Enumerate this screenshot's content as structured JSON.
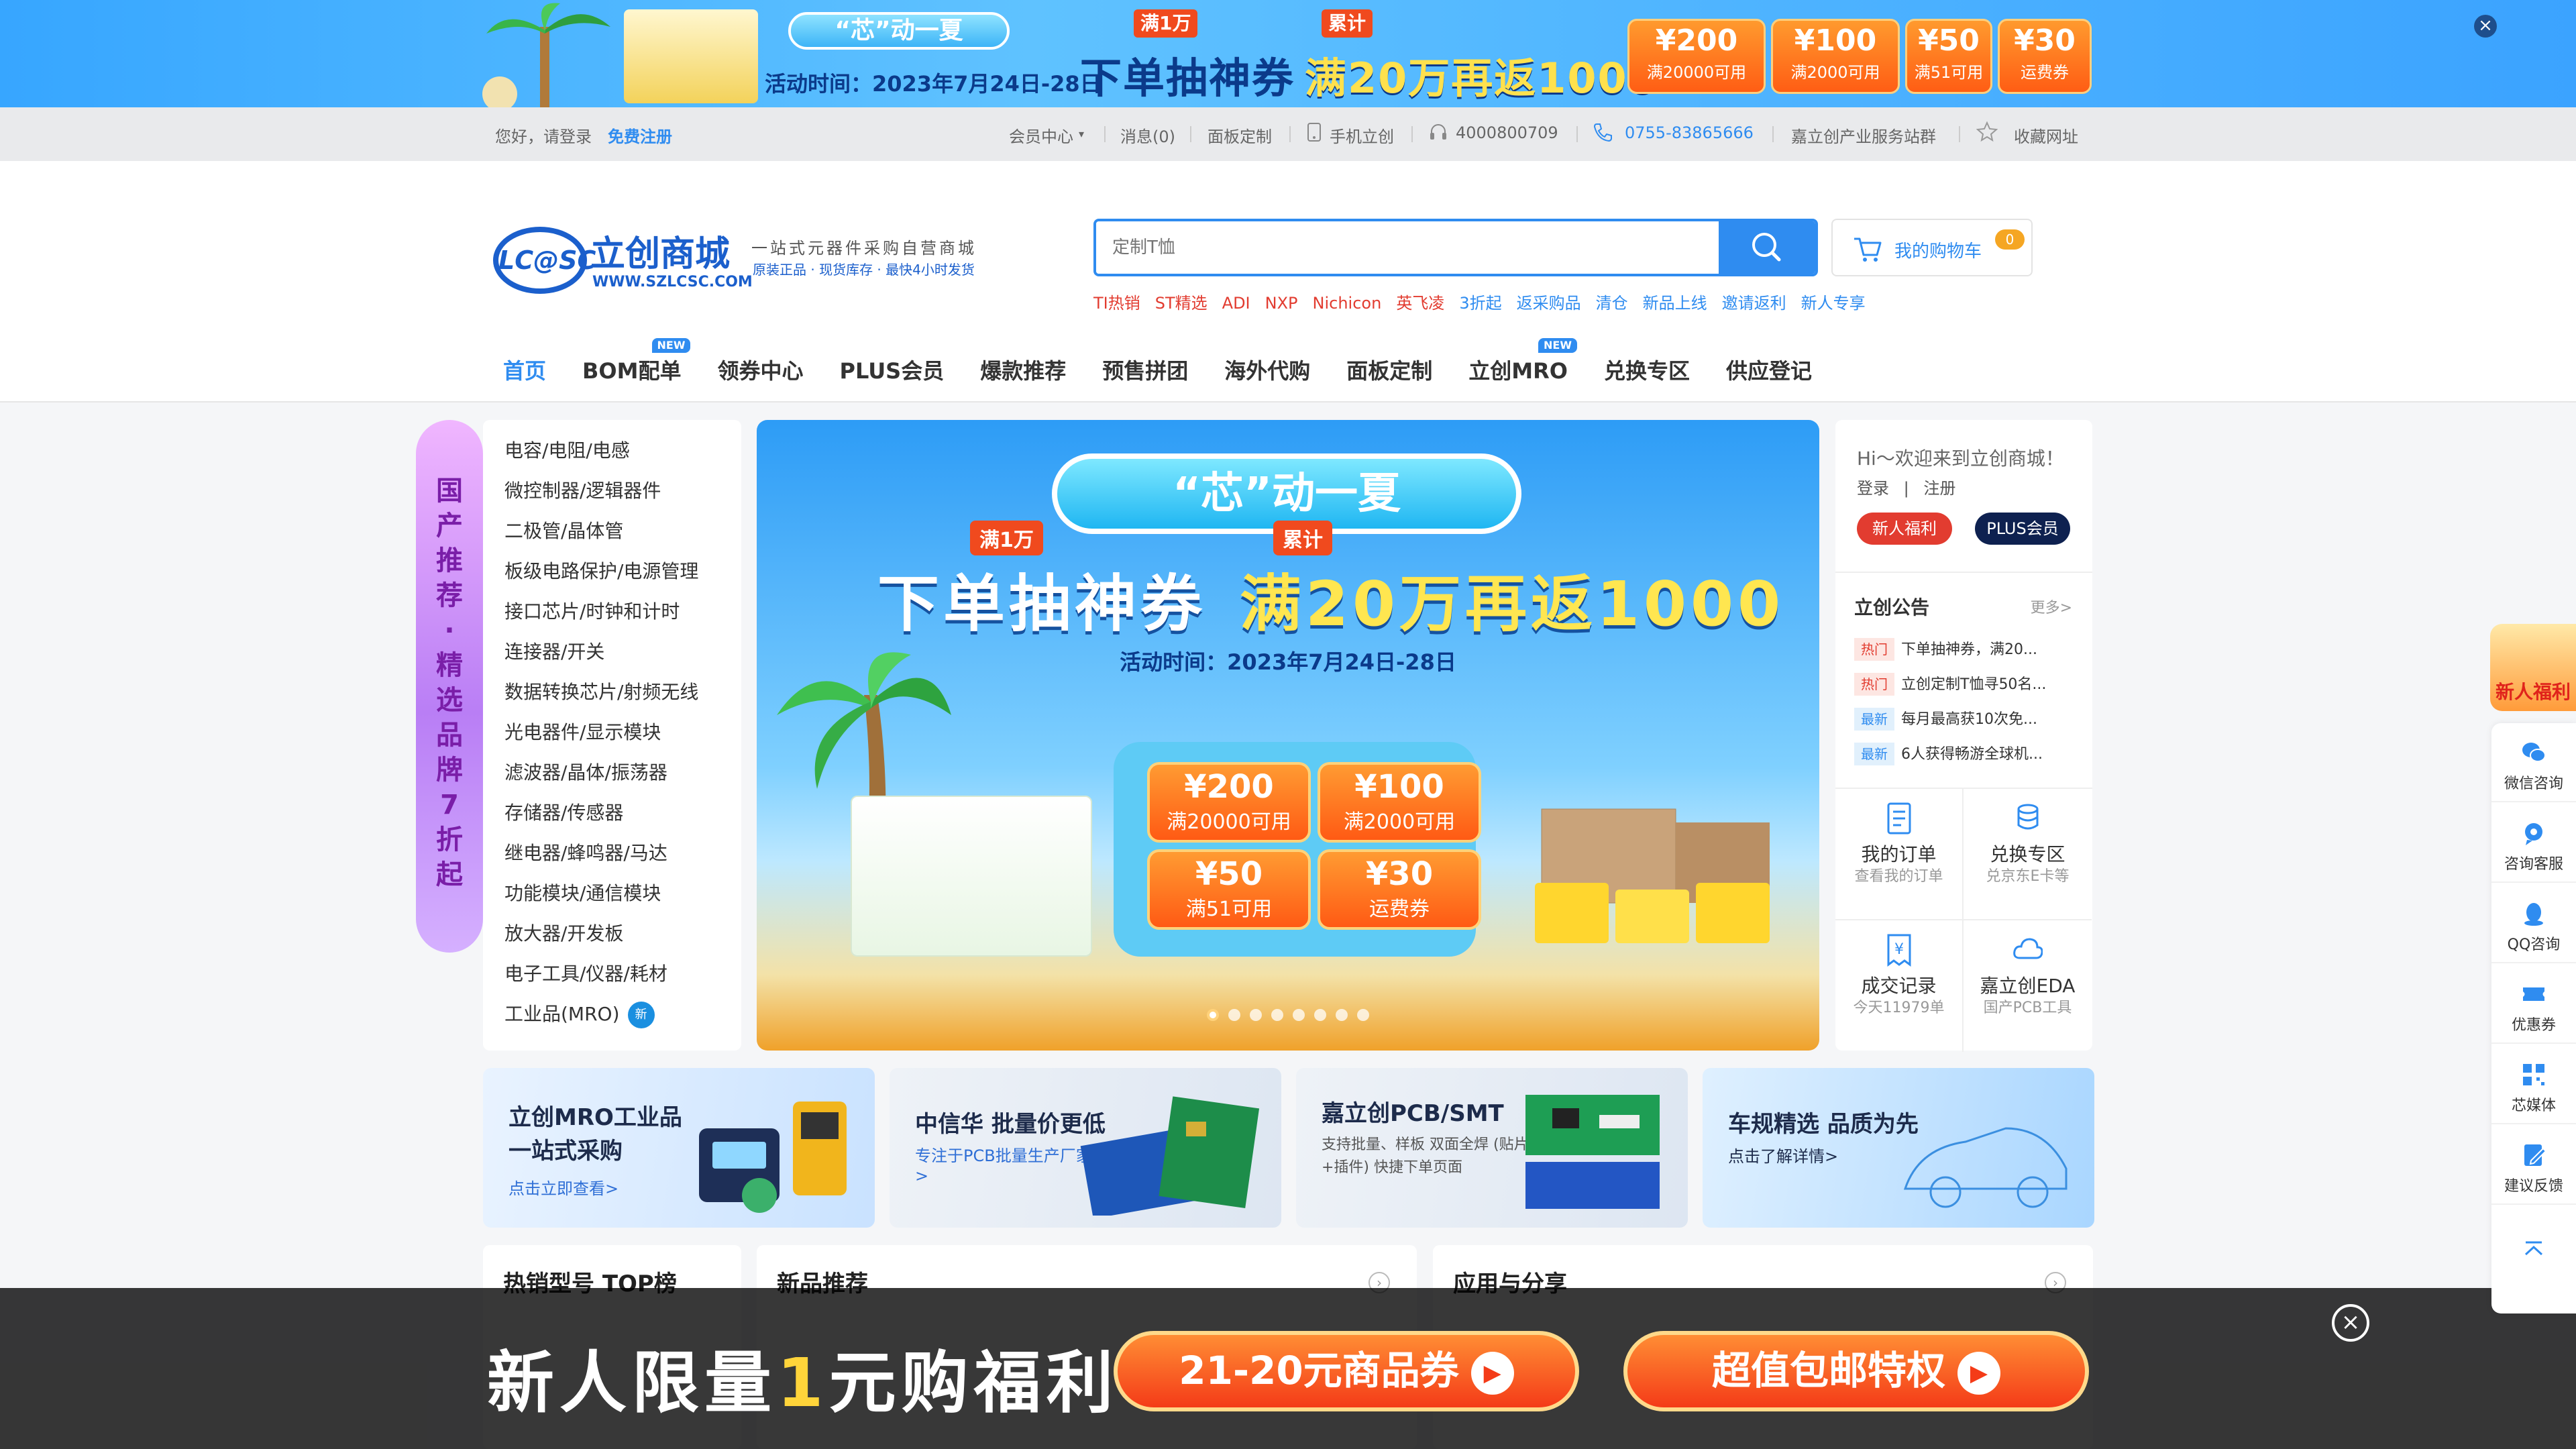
{
  "colors": {
    "primary": "#2f8cf0",
    "brand": "#1b5fcc",
    "red": "#e23c30",
    "navy": "#0e2150",
    "orange": "#ff5a14"
  },
  "top_banner": {
    "pill": "“芯”动一夏",
    "date": "活动时间：2023年7月24日-28日",
    "tag1": "满1万",
    "tag2": "累计",
    "headline1": "下单抽神券",
    "headline2": "满20万再返1000",
    "coupons": [
      {
        "value": "¥200",
        "desc": "满20000可用"
      },
      {
        "value": "¥100",
        "desc": "满2000可用"
      },
      {
        "value": "¥50",
        "desc": "满51可用"
      },
      {
        "value": "¥30",
        "desc": "运费券"
      }
    ],
    "close_icon": "close-icon"
  },
  "utility": {
    "greeting": "您好，请登录",
    "register": "免费注册",
    "member_center": "会员中心",
    "messages": "消息(0)",
    "panel_custom": "面板定制",
    "mobile": "手机立创",
    "hotline": "4000800709",
    "phone": "0755-83865666",
    "industry": "嘉立创产业服务站群",
    "bookmark": "收藏网址"
  },
  "header": {
    "logo_mark": "LC@SC",
    "logo_name": "立创商城",
    "logo_url": "WWW.SZLCSC.COM",
    "slogan1": "一站式元器件采购自营商城",
    "slogan2": "原装正品 · 现货库存 · 最快4小时发货",
    "search_placeholder": "定制T恤",
    "cart_label": "我的购物车",
    "cart_count": "0",
    "hot_links": [
      {
        "label": "TI热销",
        "color": "#e23c30"
      },
      {
        "label": "ST精选",
        "color": "#e23c30"
      },
      {
        "label": "ADI",
        "color": "#e23c30"
      },
      {
        "label": "NXP",
        "color": "#e23c30"
      },
      {
        "label": "Nichicon",
        "color": "#e23c30"
      },
      {
        "label": "英飞凌",
        "color": "#e23c30"
      },
      {
        "label": "3折起",
        "color": "#2f8cf0"
      },
      {
        "label": "返采购品",
        "color": "#2f8cf0"
      },
      {
        "label": "清仓",
        "color": "#2f8cf0"
      },
      {
        "label": "新品上线",
        "color": "#2f8cf0"
      },
      {
        "label": "邀请返利",
        "color": "#2f8cf0"
      },
      {
        "label": "新人专享",
        "color": "#2f8cf0"
      }
    ]
  },
  "nav": {
    "new_badge": "NEW",
    "items": [
      "首页",
      "BOM配单",
      "领券中心",
      "PLUS会员",
      "爆款推荐",
      "预售拼团",
      "海外代购",
      "面板定制",
      "立创MRO",
      "兑换专区",
      "供应登记"
    ]
  },
  "ribbon": {
    "text": "国产推荐·精选品牌7折起"
  },
  "categories": {
    "items": [
      "电容/电阻/电感",
      "微控制器/逻辑器件",
      "二极管/晶体管",
      "板级电路保护/电源管理",
      "接口芯片/时钟和计时",
      "连接器/开关",
      "数据转换芯片/射频无线",
      "光电器件/显示模块",
      "滤波器/晶体/振荡器",
      "存储器/传感器",
      "继电器/蜂鸣器/马达",
      "功能模块/通信模块",
      "放大器/开发板",
      "电子工具/仪器/耗材",
      "工业品(MRO)"
    ],
    "new_badge": "新"
  },
  "hero": {
    "pool": "“芯”动一夏",
    "tag1": "满1万",
    "tag2": "累计",
    "line1": "下单抽神券",
    "line2": "满20万再返1000",
    "date": "活动时间：2023年7月24日-28日",
    "coupons": [
      {
        "value": "¥200",
        "desc": "满20000可用"
      },
      {
        "value": "¥100",
        "desc": "满2000可用"
      },
      {
        "value": "¥50",
        "desc": "满51可用"
      },
      {
        "value": "¥30",
        "desc": "运费券"
      }
    ],
    "slide_count": 8,
    "active_slide": 1
  },
  "user_panel": {
    "welcome": "Hi～欢迎来到立创商城！",
    "login": "登录",
    "divider": "|",
    "register": "注册",
    "newbie_btn": "新人福利",
    "plus_btn": "PLUS会员",
    "notice_title": "立创公告",
    "more": "更多>",
    "notices": [
      {
        "tag": "热门",
        "type": "hot",
        "text": "下单抽神券，满20..."
      },
      {
        "tag": "热门",
        "type": "hot",
        "text": "立创定制T恤寻50名..."
      },
      {
        "tag": "最新",
        "type": "new",
        "text": "每月最高获10次免..."
      },
      {
        "tag": "最新",
        "type": "new",
        "text": "6人获得畅游全球机..."
      }
    ],
    "shortcuts": [
      {
        "title": "我的订单",
        "sub": "查看我的订单",
        "icon": "order-icon"
      },
      {
        "title": "兑换专区",
        "sub": "兑京东E卡等",
        "icon": "coins-icon"
      },
      {
        "title": "成交记录",
        "sub": "今天11979单",
        "icon": "receipt-icon"
      },
      {
        "title": "嘉立创EDA",
        "sub": "国产PCB工具",
        "icon": "cloud-icon"
      }
    ]
  },
  "promo_cards": [
    {
      "title": "立创MRO工业品",
      "title2": "一站式采购",
      "sub": "点击立即查看>"
    },
    {
      "title": "中信华 批量价更低",
      "title2": "",
      "sub": "专注于PCB批量生产厂家>"
    },
    {
      "title": "嘉立创PCB/SMT",
      "title2": "",
      "sub": "支持批量、样板  双面全焊 (贴片+插件)  快捷下单页面"
    },
    {
      "title": "车规精选 品质为先",
      "title2": "",
      "sub": "点击了解详情>"
    }
  ],
  "sections": {
    "hot": "热销型号 TOP榜",
    "new_products": "新品推荐",
    "apps": "应用与分享"
  },
  "bottom_overlay": {
    "headline_a": "新人限量",
    "headline_b": "1",
    "headline_c": "元购福利",
    "btn1": "21-20元商品券",
    "btn2": "超值包邮特权"
  },
  "side_bar": {
    "gift": "新人福利",
    "items": [
      {
        "label": "微信咨询",
        "icon": "wechat-icon"
      },
      {
        "label": "咨询客服",
        "icon": "service-icon"
      },
      {
        "label": "QQ咨询",
        "icon": "qq-icon"
      },
      {
        "label": "优惠券",
        "icon": "coupon-icon"
      },
      {
        "label": "芯媒体",
        "icon": "qrcode-icon"
      },
      {
        "label": "建议反馈",
        "icon": "feedback-icon"
      }
    ]
  }
}
